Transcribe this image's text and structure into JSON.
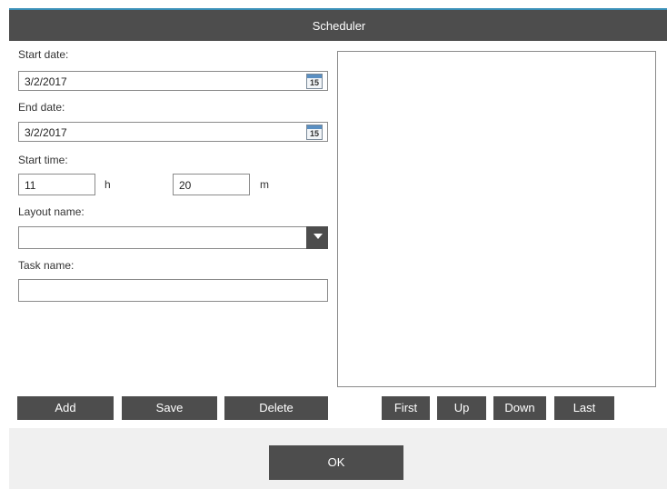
{
  "window": {
    "title": "Scheduler"
  },
  "form": {
    "start_date_label": "Start date:",
    "start_date_value": "3/2/2017",
    "end_date_label": "End date:",
    "end_date_value": "3/2/2017",
    "calendar_day": "15",
    "start_time_label": "Start time:",
    "hour_value": "11",
    "hour_unit": "h",
    "minute_value": "20",
    "minute_unit": "m",
    "layout_name_label": "Layout name:",
    "layout_name_value": "",
    "task_name_label": "Task name:",
    "task_name_value": ""
  },
  "list_actions": {
    "add": "Add",
    "save": "Save",
    "delete": "Delete"
  },
  "order_actions": {
    "first": "First",
    "up": "Up",
    "down": "Down",
    "last": "Last"
  },
  "footer": {
    "ok": "OK"
  },
  "colors": {
    "button_bg": "#4d4d4d",
    "titlebar_bg": "#4d4d4d",
    "accent": "#3a8fb7",
    "footer_bg": "#f0f0f0"
  }
}
